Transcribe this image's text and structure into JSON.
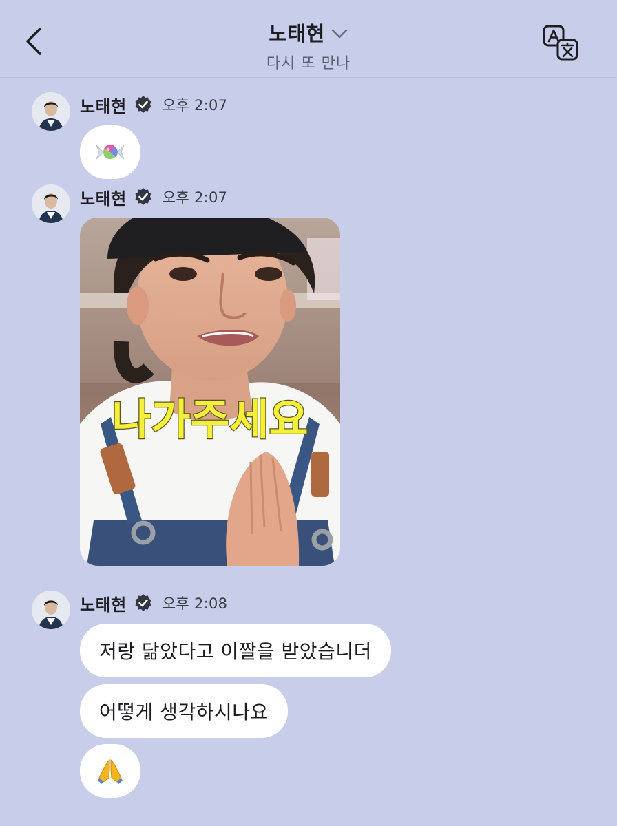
{
  "header": {
    "title": "노태현",
    "subtitle": "다시 또 만나",
    "back_icon": "chevron-left-icon",
    "translate_icon": "translate-icon"
  },
  "messages": [
    {
      "sender": "노태현",
      "time": "오후 2:07",
      "type": "emoji",
      "icon": "candy-icon"
    },
    {
      "sender": "노태현",
      "time": "오후 2:07",
      "type": "image",
      "caption": "나가주세요"
    },
    {
      "sender": "노태현",
      "time": "오후 2:08",
      "type": "text",
      "texts": [
        "저랑 닮았다고 이짤을 받았습니더",
        "어떻게 생각하시나요"
      ],
      "emoji_icon": "folded-hands-icon"
    }
  ],
  "colors": {
    "background": "#c8cde9",
    "bubble": "#ffffff",
    "caption_yellow": "#f4f03a"
  }
}
